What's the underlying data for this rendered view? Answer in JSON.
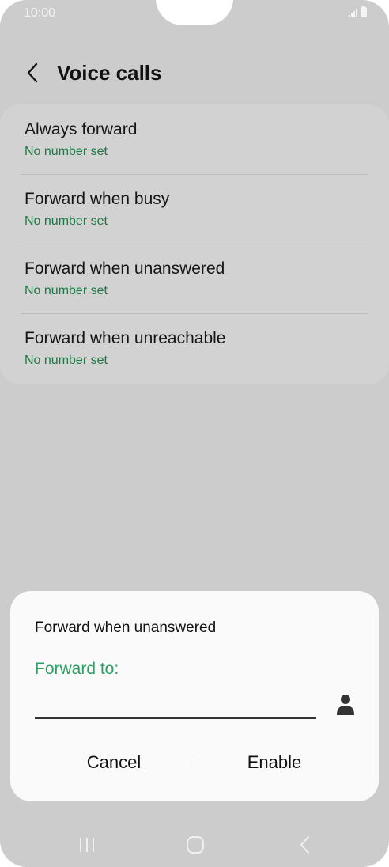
{
  "status_bar": {
    "time": "10:00"
  },
  "header": {
    "title": "Voice calls"
  },
  "settings": [
    {
      "label": "Always forward",
      "sub": "No number set"
    },
    {
      "label": "Forward when busy",
      "sub": "No number set"
    },
    {
      "label": "Forward when unanswered",
      "sub": "No number set"
    },
    {
      "label": "Forward when unreachable",
      "sub": "No number set"
    }
  ],
  "dialog": {
    "title": "Forward when unanswered",
    "field_label": "Forward to:",
    "field_value": "",
    "cancel_label": "Cancel",
    "enable_label": "Enable"
  },
  "colors": {
    "accent_green": "#2e9e63",
    "subtext_green": "#1a7a45",
    "scrim_background": "#cccccc"
  },
  "icons": {
    "back": "chevron-left-icon",
    "contact": "person-icon",
    "nav_recents": "recents-icon",
    "nav_home": "home-icon",
    "nav_back": "back-icon"
  }
}
